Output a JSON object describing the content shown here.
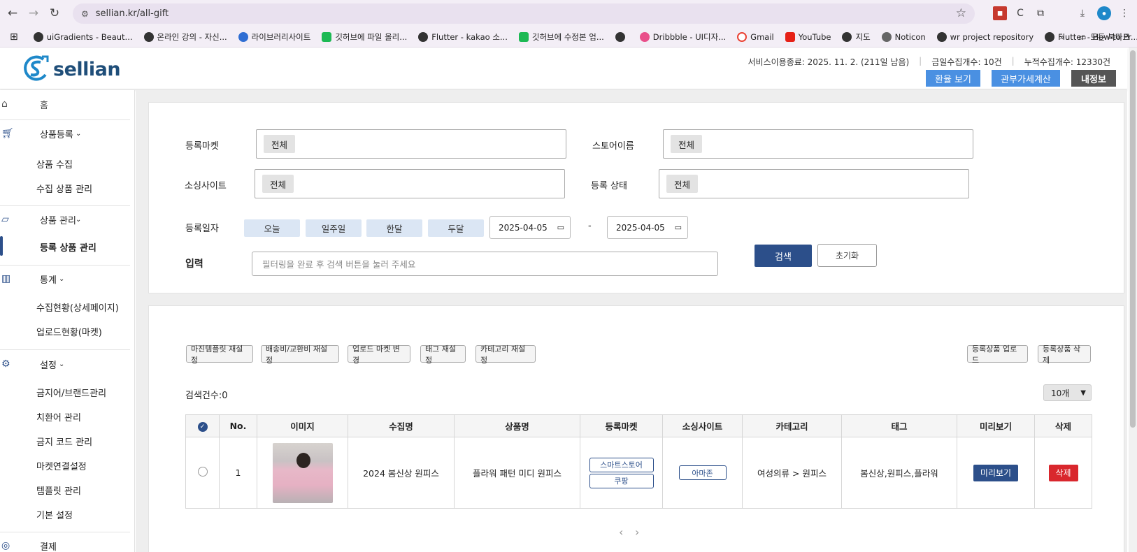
{
  "browser": {
    "url": "sellian.kr/all-gift",
    "bookmarks": [
      "uiGradients - Beaut...",
      "온라인 강의 - 자신...",
      "라이브러리사이트",
      "깃허브에 파일 올리...",
      "Flutter - kakao 소...",
      "깃허브에 수정본 업...",
      "",
      "Dribbble - UI디자...",
      "Gmail",
      "YouTube",
      "지도",
      "Noticon",
      "wr project repository",
      "Flutter - How to Pr..."
    ],
    "more": "»",
    "all_bookmarks": "모든 북마크"
  },
  "header": {
    "logo_text": "sellian",
    "service_end": "서비스이용종료: 2025. 11. 2. (211일 남음)",
    "today_count": "금일수집개수: 10건",
    "total_count": "누적수집개수: 12330건",
    "btn_exchange": "환율 보기",
    "btn_tax": "관부가세계산",
    "btn_myinfo": "내정보",
    "colors": {
      "blue_btn": "#4a90e2",
      "dark_btn": "#555555",
      "primary": "#2c4f8a",
      "danger": "#d9272d"
    }
  },
  "sidebar": {
    "home": "홈",
    "product_register": "상품등록",
    "product_collect": "상품 수집",
    "collected_manage": "수집 상품 관리",
    "product_manage": "상품 관리",
    "registered_manage": "등록 상품 관리",
    "stats": "통계",
    "collect_status": "수집현황(상세페이지)",
    "upload_status": "업로드현황(마켓)",
    "settings": "설정",
    "banned_brand": "금지어/브랜드관리",
    "replace_word": "치환어 관리",
    "banned_code": "금지 코드 관리",
    "market_link": "마켓연결설정",
    "template": "템플릿 관리",
    "basic_settings": "기본 설정",
    "payment": "결제"
  },
  "filter": {
    "market_label": "등록마켓",
    "market_value": "전체",
    "store_label": "스토어이름",
    "store_value": "전체",
    "source_label": "소싱사이트",
    "source_value": "전체",
    "status_label": "등록 상태",
    "status_value": "전체",
    "date_label": "등록일자",
    "today": "오늘",
    "week": "일주일",
    "month": "한달",
    "two_months": "두달",
    "date_from": "2025-04-05",
    "date_sep": "-",
    "date_to": "2025-04-05",
    "input_label": "입력",
    "input_placeholder": "필터링을 완료 후 검색 버튼을 눌러 주세요",
    "search": "검색",
    "reset": "초기화"
  },
  "actions": {
    "margin_template": "마진템플릿 재설정",
    "shipping_fee": "배송비/교환비 재설정",
    "upload_market": "업로드 마켓 변경",
    "tag_reset": "태그 재설정",
    "category_reset": "카테고리 재설정",
    "upload_registered": "등록상품 업로드",
    "delete_registered": "등록상품 삭제"
  },
  "results": {
    "count_text": "검색건수:0",
    "per_page": "10개",
    "columns": [
      "No.",
      "이미지",
      "수집명",
      "상품명",
      "등록마켓",
      "소싱사이트",
      "카테고리",
      "태그",
      "미리보기",
      "삭제"
    ],
    "rows": [
      {
        "no": "1",
        "collect_name": "2024 봄신상 원피스",
        "product_name": "플라워 패턴 미디 원피스",
        "market_1": "스마트스토어",
        "market_2": "쿠팡",
        "source": "아마존",
        "category": "여성의류 > 원피스",
        "tags": "봄신상,원피스,플라워",
        "preview": "미리보기",
        "delete": "삭제"
      }
    ],
    "prev": "‹",
    "next": "›"
  }
}
